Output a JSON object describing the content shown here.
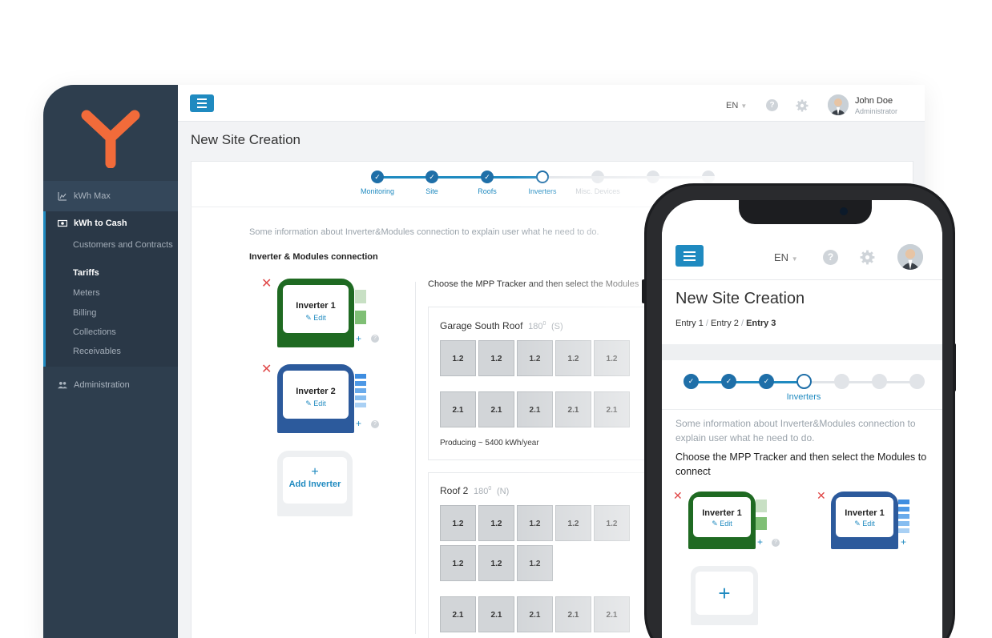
{
  "app": {
    "logo": "Y-logo"
  },
  "sidebar": {
    "sections": [
      {
        "label": "kWh Max",
        "icon": "chart-icon"
      },
      {
        "label": "kWh to Cash",
        "icon": "cash-icon"
      },
      {
        "label": "Administration",
        "icon": "users-icon"
      }
    ],
    "sub_items": [
      "Customers and Contracts",
      "Tariffs",
      "Meters",
      "Billing",
      "Collections",
      "Receivables"
    ],
    "active_sub": "Tariffs"
  },
  "header": {
    "lang": "EN",
    "user_name": "John Doe",
    "user_role": "Administrator"
  },
  "page": {
    "title": "New Site Creation",
    "steps": [
      "Monitoring",
      "Site",
      "Roofs",
      "Inverters",
      "Misc. Devices",
      "",
      ""
    ],
    "info": "Some information about Inverter&Modules connection to explain user what he need to do.",
    "section_title": "Inverter & Modules connection",
    "choose": "Choose the MPP Tracker and then select the Modules",
    "inverters": [
      {
        "name": "Inverter 1",
        "edit": "Edit",
        "color": "#1f6a22"
      },
      {
        "name": "Inverter 2",
        "edit": "Edit",
        "color": "#2c5a9c"
      }
    ],
    "add_inverter": "Add Inverter",
    "roofs": [
      {
        "name": "Garage South Roof",
        "angle": "180",
        "deg": "0",
        "dir": "(S)",
        "row1": "1.2",
        "row2": "2.1",
        "producing": "Producing ~ 5400 kWh/year"
      },
      {
        "name": "Roof 2",
        "angle": "180",
        "deg": "0",
        "dir": "(N)",
        "row1": "1.2",
        "row2": "2.1"
      }
    ]
  },
  "mobile": {
    "lang": "EN",
    "title": "New Site Creation",
    "crumbs": [
      "Entry 1",
      "Entry 2",
      "Entry 3"
    ],
    "current_step": "Inverters",
    "info": "Some information about Inverter&Modules connection to explain user what he need to do.",
    "choose": "Choose the MPP Tracker and then select the Modules to connect",
    "inverters": [
      {
        "name": "Inverter 1",
        "edit": "Edit"
      },
      {
        "name": "Inverter 1",
        "edit": "Edit"
      }
    ]
  },
  "colors": {
    "accent": "#1f8ac0",
    "sidebar": "#2e3e4e",
    "logo": "#f26b3a",
    "inv_green": "#1f6a22",
    "inv_blue": "#2c5a9c"
  }
}
